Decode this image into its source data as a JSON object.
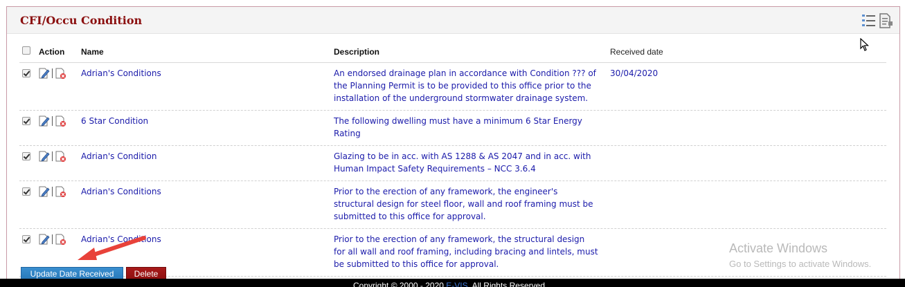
{
  "panel": {
    "title": "CFI/Occu Condition"
  },
  "icons": {
    "header_list": "list-icon",
    "header_doc": "document-edit-icon",
    "row_edit": "edit-icon",
    "row_delete": "delete-document-icon"
  },
  "table": {
    "columns": {
      "action": "Action",
      "name": "Name",
      "description": "Description",
      "received_date": "Received date"
    },
    "rows": [
      {
        "checked": true,
        "name": "Adrian's Conditions",
        "description_lines": [
          "An endorsed drainage plan in accordance with Condition ??? of",
          "the Planning Permit is to be provided to this office prior to the",
          "installation of the underground stormwater drainage system."
        ],
        "received_date": "30/04/2020"
      },
      {
        "checked": true,
        "name": "6 Star Condition",
        "description_lines": [
          "The following dwelling must have a minimum 6 Star Energy",
          "Rating"
        ],
        "received_date": ""
      },
      {
        "checked": true,
        "name": "Adrian's Condition",
        "description_lines": [
          "Glazing to be in acc. with AS 1288 & AS 2047 and in acc. with",
          "Human Impact Safety Requirements – NCC 3.6.4"
        ],
        "received_date": ""
      },
      {
        "checked": true,
        "name": "Adrian's Conditions",
        "description_lines": [
          "Prior to the erection of any framework, the engineer's",
          "structural design for steel floor, wall and roof framing must be",
          "submitted to this office for approval."
        ],
        "received_date": ""
      },
      {
        "checked": true,
        "name": "Adrian's Conditions",
        "description_lines": [
          "Prior to the erection of any framework, the structural design",
          "for all wall and roof framing, including bracing and lintels, must",
          "be submitted to this office for approval."
        ],
        "received_date": ""
      }
    ]
  },
  "buttons": {
    "update": "Update Date Received",
    "delete": "Delete"
  },
  "footer": {
    "prefix": "Copyright © 2000 - 2020 ",
    "link": "E-VIS",
    "suffix": ". All Rights Reserved"
  },
  "watermark": {
    "line1": "Activate Windows",
    "line2": "Go to Settings to activate Windows."
  },
  "colors": {
    "title": "#8b1010",
    "link": "#1a1aaa",
    "update_button": "#2677b8",
    "delete_button": "#8c0e0e"
  }
}
